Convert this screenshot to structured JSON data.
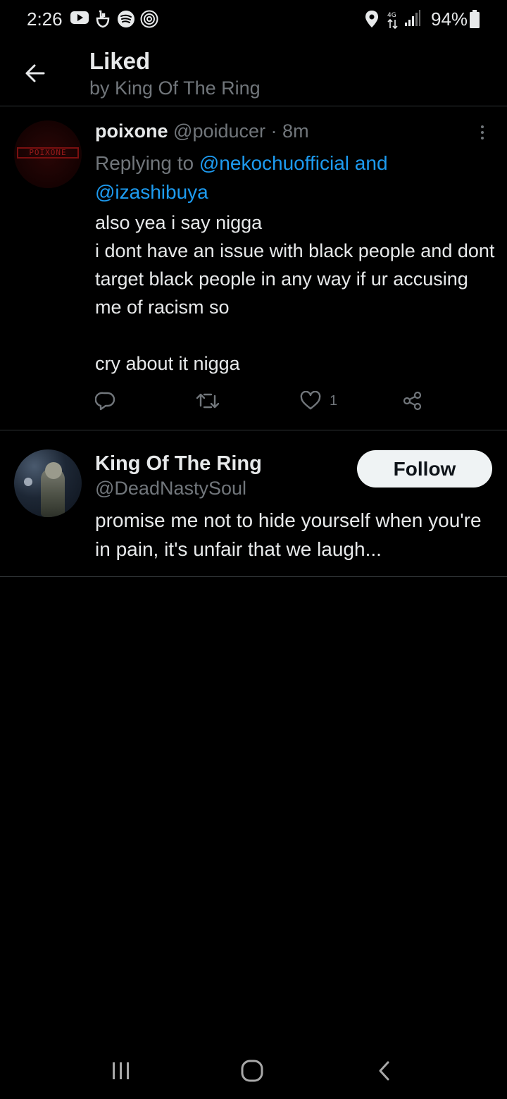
{
  "status_bar": {
    "time": "2:26",
    "battery": "94%",
    "icons": [
      "youtube-icon",
      "hands-icon",
      "spotify-icon",
      "threads-icon",
      "location-icon",
      "data-arrows-icon",
      "signal-icon",
      "battery-icon"
    ]
  },
  "header": {
    "title": "Liked",
    "subtitle": "by King Of The Ring"
  },
  "tweet": {
    "display_name": "poixone",
    "handle": "@poiducer",
    "separator": "·",
    "time": "8m",
    "replying_prefix": "Replying to ",
    "mention1": "@nekochuofficial",
    "conjunction": " and",
    "mention2": "@izashibuya",
    "body": "also yea i say nigga\ni dont have an issue with black people and dont target black people in any way if ur accusing me of racism so\n\ncry about it nigga",
    "avatar_logo_text": "POIXONE",
    "like_count": "1"
  },
  "user_card": {
    "display_name": "King Of The Ring",
    "handle": "@DeadNastySoul",
    "bio": "promise me not to hide yourself when you're in pain, it's unfair that we laugh...",
    "follow_label": "Follow"
  },
  "colors": {
    "background": "#000000",
    "text_primary": "#e7e9ea",
    "text_secondary": "#71767b",
    "link": "#1d9bf0",
    "divider": "#2f3336",
    "follow_button_bg": "#eff3f4"
  }
}
